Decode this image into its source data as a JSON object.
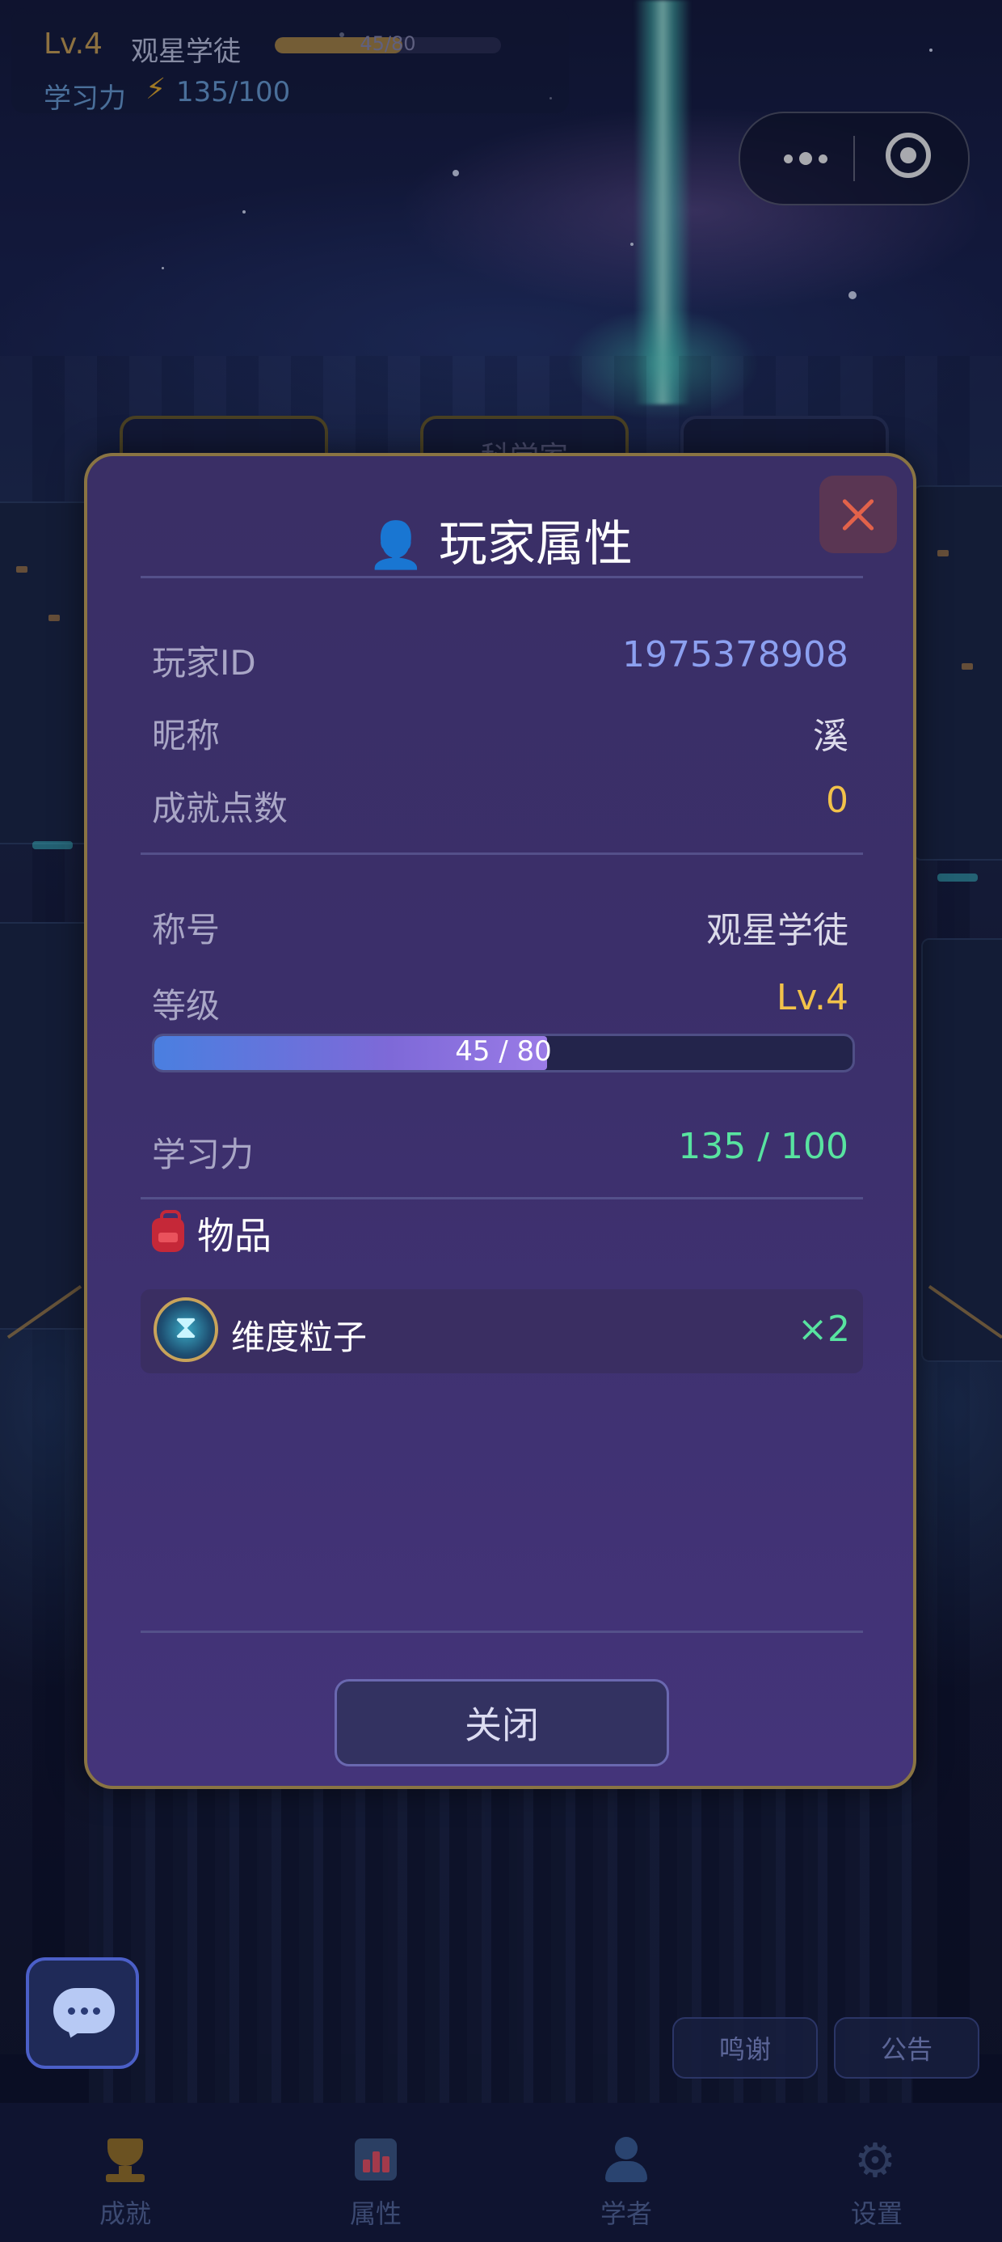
{
  "hud": {
    "level": "Lv.4",
    "title": "观星学徒",
    "xp_text": "45/80",
    "xp_fraction": 0.5625,
    "power_label": "学习力",
    "power_icon": "lightning-icon",
    "power_value": "135/100"
  },
  "capsule": {
    "more_icon": "more-dots-icon",
    "close_icon": "target-circle-icon"
  },
  "background_tabs": [
    "",
    "科学家",
    ""
  ],
  "modal": {
    "title_icon": "user-icon",
    "title": "玩家属性",
    "close_icon": "close-x-icon",
    "player_id_label": "玩家ID",
    "player_id": "1975378908",
    "nickname_label": "昵称",
    "nickname": "溪",
    "achievement_label": "成就点数",
    "achievement_points": "0",
    "rank_label": "称号",
    "rank": "观星学徒",
    "level_label": "等级",
    "level": "Lv.4",
    "level_progress_text": "45 / 80",
    "level_progress_fraction": 0.5625,
    "power_label": "学习力",
    "power": "135 / 100",
    "items_icon": "backpack-icon",
    "items_label": "物品",
    "items": [
      {
        "icon": "hourglass-orb-icon",
        "name": "维度粒子",
        "count": "×2"
      }
    ],
    "close_button": "关闭"
  },
  "chat_button_icon": "chat-bubble-icon",
  "side_buttons": {
    "thanks": "鸣谢",
    "notice": "公告"
  },
  "nav": [
    {
      "icon": "trophy-icon",
      "label": "成就"
    },
    {
      "icon": "bar-chart-icon",
      "label": "属性"
    },
    {
      "icon": "person-icon",
      "label": "学者"
    },
    {
      "icon": "gear-icon",
      "label": "设置"
    }
  ],
  "colors": {
    "modal_bg": "#3b2f6a",
    "modal_border": "#8a7443",
    "accent_blue": "#8ca0f0",
    "accent_gold": "#f2c24a",
    "accent_green": "#58e3a0",
    "close_red": "#e2624a"
  }
}
